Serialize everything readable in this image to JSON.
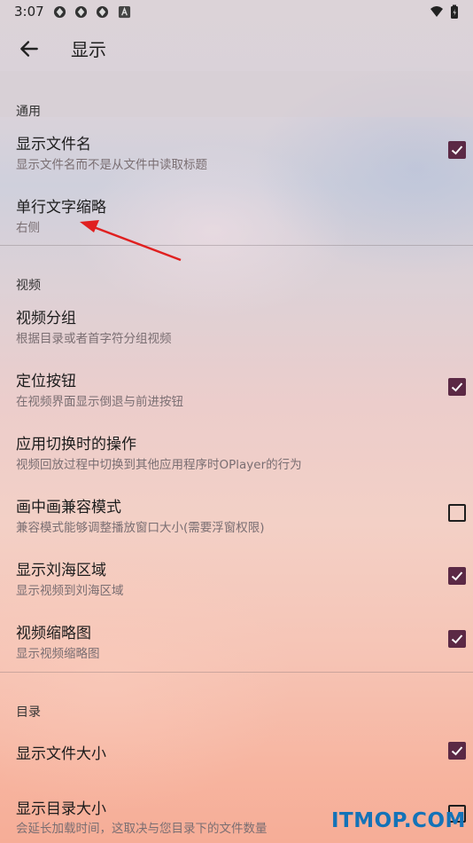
{
  "status_bar": {
    "time": "3:07",
    "icons": [
      "app-icon",
      "app-icon",
      "app-icon",
      "a-icon"
    ],
    "right_icons": [
      "wifi-icon",
      "battery-icon"
    ]
  },
  "app_bar": {
    "back_icon": "arrow-left-icon",
    "title": "显示"
  },
  "sections": [
    {
      "header": "通用",
      "items": [
        {
          "title": "显示文件名",
          "summary": "显示文件名而不是从文件中读取标题",
          "checked": true
        },
        {
          "title": "单行文字缩略",
          "summary": "右侧"
        }
      ]
    },
    {
      "header": "视频",
      "items": [
        {
          "title": "视频分组",
          "summary": "根据目录或者首字符分组视频"
        },
        {
          "title": "定位按钮",
          "summary": "在视频界面显示倒退与前进按钮",
          "checked": true
        },
        {
          "title": "应用切换时的操作",
          "summary": "视频回放过程中切换到其他应用程序时OPlayer的行为"
        },
        {
          "title": "画中画兼容模式",
          "summary": "兼容模式能够调整播放窗口大小(需要浮窗权限)",
          "checked": false
        },
        {
          "title": "显示刘海区域",
          "summary": "显示视频到刘海区域",
          "checked": true
        },
        {
          "title": "视频缩略图",
          "summary": "显示视频缩略图",
          "checked": true
        }
      ]
    },
    {
      "header": "目录",
      "items": [
        {
          "title": "显示文件大小",
          "checked": true
        },
        {
          "title": "显示目录大小",
          "summary": "会延长加载时间，这取决与您目录下的文件数量",
          "checked": false
        }
      ]
    }
  ],
  "colors": {
    "checkbox_checked": "#5b2945",
    "annotation_arrow": "#e02020",
    "watermark": "#1473b8"
  },
  "watermark": "ITMOP.COM"
}
